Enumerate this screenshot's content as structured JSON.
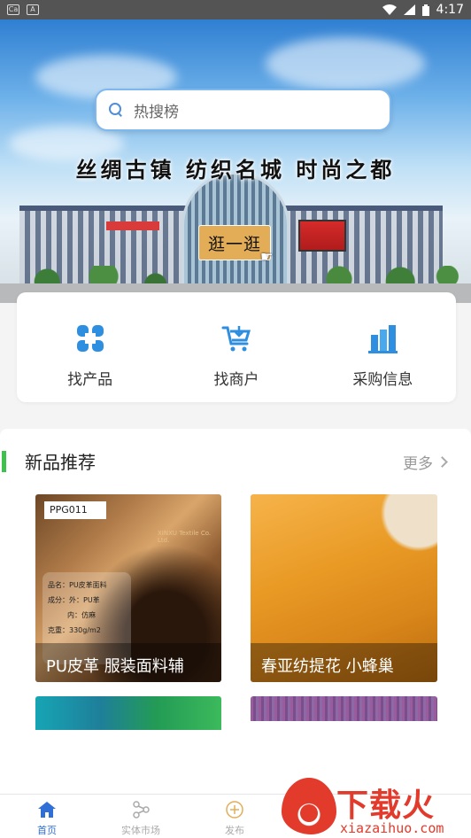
{
  "status_bar": {
    "time": "4:17",
    "left_icons": [
      "notification-icon-1",
      "notification-icon-2"
    ],
    "right_icons": [
      "wifi-icon",
      "signal-icon",
      "battery-icon"
    ]
  },
  "hero": {
    "search_placeholder": "热搜榜",
    "slogan": "丝绸古镇 纺织名城 时尚之都",
    "visit_button": "逛一逛"
  },
  "quick_menu": [
    {
      "label": "找产品",
      "icon": "find-product-icon"
    },
    {
      "label": "找商户",
      "icon": "find-merchant-icon"
    },
    {
      "label": "采购信息",
      "icon": "purchase-info-icon"
    }
  ],
  "new_products": {
    "title": "新品推荐",
    "more": "更多",
    "items": [
      {
        "caption": "PU皮革 服装面料辅",
        "tag": "PPG011",
        "brand": "XINXU Textile Co. Ltd.",
        "spec": [
          "品名：PU皮革面料",
          "成分：外：PU革",
          "内：仿麻",
          "克重：330g/m2"
        ]
      },
      {
        "caption": "春亚纺提花 小蜂巢"
      },
      {
        "caption": ""
      },
      {
        "caption": ""
      }
    ]
  },
  "tab_bar": [
    {
      "label": "首页",
      "icon": "home-icon",
      "active": true
    },
    {
      "label": "实体市场",
      "icon": "market-icon",
      "active": false
    },
    {
      "label": "发布",
      "icon": "publish-icon",
      "active": false
    }
  ],
  "watermark": {
    "text": "下载火",
    "domain": "xiazaihuo.com"
  },
  "colors": {
    "accent_blue": "#2f6fd6",
    "section_green": "#3fc24d",
    "button_gold": "#e3ad58",
    "watermark_red": "#e23a2b"
  }
}
